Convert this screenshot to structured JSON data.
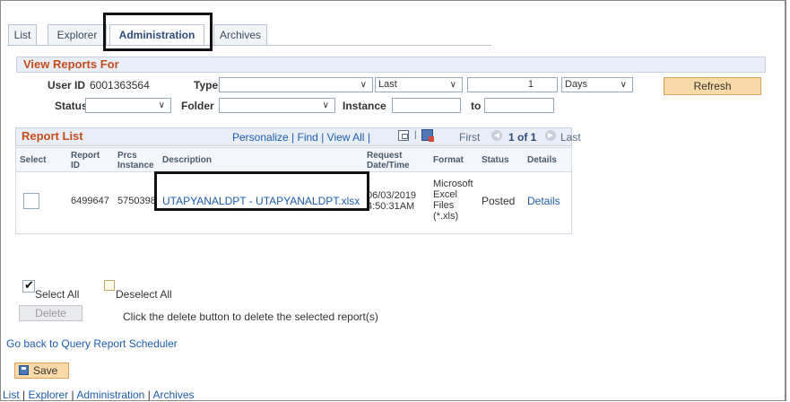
{
  "tabs": [
    {
      "label": "List",
      "active": false
    },
    {
      "label": "Explorer",
      "active": false
    },
    {
      "label": "Administration",
      "active": true
    },
    {
      "label": "Archives",
      "active": false
    }
  ],
  "view_reports": {
    "title": "View Reports For",
    "user_id_label": "User ID",
    "user_id_value": "6001363564",
    "type_label": "Type",
    "type_value": "",
    "last_value": "Last",
    "count_value": "1",
    "days_value": "Days",
    "refresh_label": "Refresh",
    "status_label": "Status",
    "status_value": "",
    "folder_label": "Folder",
    "folder_value": "",
    "instance_label": "Instance",
    "instance_value": "",
    "to_label": "to",
    "to_value": ""
  },
  "report_list": {
    "title": "Report List",
    "personalize": "Personalize",
    "find": "Find",
    "view_all": "View All",
    "first": "First",
    "range": "1 of 1",
    "last": "Last",
    "columns": {
      "select": "Select",
      "report_id": "Report ID",
      "prcs_instance": "Prcs Instance",
      "description": "Description",
      "request_datetime": "Request Date/Time",
      "format": "Format",
      "status": "Status",
      "details": "Details"
    },
    "rows": [
      {
        "report_id": "6499647",
        "prcs_instance": "5750398",
        "description": "UTAPYANALDPT - UTAPYANALDPT.xlsx",
        "date": "06/03/2019",
        "time": "4:50:31AM",
        "format_lines": [
          "Microsoft",
          "Excel",
          "Files",
          "(*.xls)"
        ],
        "status": "Posted",
        "details": "Details"
      }
    ]
  },
  "actions": {
    "select_all": "Select All",
    "deselect_all": "Deselect All",
    "delete_label": "Delete",
    "delete_hint": "Click the delete button to delete the selected report(s)",
    "back_link": "Go back to Query Report Scheduler",
    "save_label": "Save"
  },
  "footer": {
    "list": "List",
    "explorer": "Explorer",
    "administration": "Administration",
    "archives": "Archives",
    "sep": "|"
  }
}
